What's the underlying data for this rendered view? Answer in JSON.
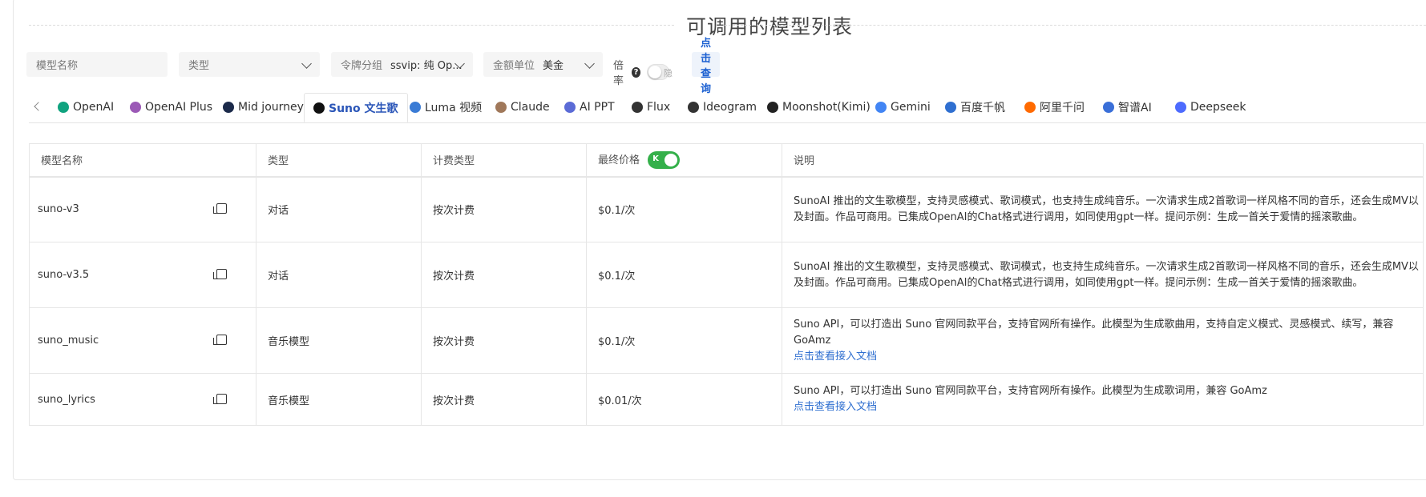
{
  "page": {
    "title": "可调用的模型列表"
  },
  "filters": {
    "model_name_placeholder": "模型名称",
    "type_label": "类型",
    "token_group_label": "令牌分组",
    "token_group_value": "ssvip: 纯 Op...",
    "currency_label": "金额单位",
    "currency_value": "美金",
    "rate_label": "倍率",
    "rate_toggle_text": "隐",
    "query_button": "点击查询"
  },
  "tabs": [
    {
      "label": "OpenAI",
      "icon": "openai-icon",
      "color": "#10a37f"
    },
    {
      "label": "OpenAI Plus",
      "icon": "openai-plus-icon",
      "color": "#9b59b6"
    },
    {
      "label": "Mid journey",
      "icon": "midjourney-icon",
      "color": "#1b2a4a"
    },
    {
      "label": "Suno 文生歌",
      "icon": "suno-icon",
      "color": "#111111",
      "active": true
    },
    {
      "label": "Luma 视频",
      "icon": "luma-icon",
      "color": "#3a7bd5"
    },
    {
      "label": "Claude",
      "icon": "claude-icon",
      "color": "#a0785a"
    },
    {
      "label": "AI PPT",
      "icon": "ai-ppt-icon",
      "color": "#5b6bd6"
    },
    {
      "label": "Flux",
      "icon": "flux-icon",
      "color": "#333333"
    },
    {
      "label": "Ideogram",
      "icon": "ideogram-icon",
      "color": "#333333"
    },
    {
      "label": "Moonshot(Kimi)",
      "icon": "kimi-icon",
      "color": "#222222"
    },
    {
      "label": "Gemini",
      "icon": "gemini-icon",
      "color": "#4285f4"
    },
    {
      "label": "百度千帆",
      "icon": "baidu-icon",
      "color": "#2f6fd0"
    },
    {
      "label": "阿里千问",
      "icon": "qwen-icon",
      "color": "#ff6a00"
    },
    {
      "label": "智谱AI",
      "icon": "zhipu-icon",
      "color": "#3a6fd8"
    },
    {
      "label": "Deepseek",
      "icon": "deepseek-icon",
      "color": "#4d6bfe"
    }
  ],
  "table": {
    "headers": {
      "name": "模型名称",
      "type": "类型",
      "billing": "计费类型",
      "price": "最终价格",
      "price_toggle": "K",
      "desc": "说明"
    },
    "rows": [
      {
        "name": "suno-v3",
        "type": "对话",
        "billing": "按次计费",
        "price": "$0.1/次",
        "desc": "SunoAI 推出的文生歌模型，支持灵感模式、歌词模式，也支持生成纯音乐。一次请求生成2首歌词一样风格不同的音乐，还会生成MV以及封面。作品可商用。已集成OpenAI的Chat格式进行调用，如同使用gpt一样。提问示例：生成一首关于爱情的摇滚歌曲。",
        "link": ""
      },
      {
        "name": "suno-v3.5",
        "type": "对话",
        "billing": "按次计费",
        "price": "$0.1/次",
        "desc": "SunoAI 推出的文生歌模型，支持灵感模式、歌词模式，也支持生成纯音乐。一次请求生成2首歌词一样风格不同的音乐，还会生成MV以及封面。作品可商用。已集成OpenAI的Chat格式进行调用，如同使用gpt一样。提问示例：生成一首关于爱情的摇滚歌曲。",
        "link": ""
      },
      {
        "name": "suno_music",
        "type": "音乐模型",
        "billing": "按次计费",
        "price": "$0.1/次",
        "desc": "Suno API，可以打造出 Suno 官网同款平台，支持官网所有操作。此模型为生成歌曲用，支持自定义模式、灵感模式、续写，兼容 GoAmz",
        "link": "点击查看接入文档"
      },
      {
        "name": "suno_lyrics",
        "type": "音乐模型",
        "billing": "按次计费",
        "price": "$0.01/次",
        "desc": "Suno API，可以打造出 Suno 官网同款平台，支持官网所有操作。此模型为生成歌词用，兼容 GoAmz",
        "link": "点击查看接入文档"
      }
    ]
  }
}
